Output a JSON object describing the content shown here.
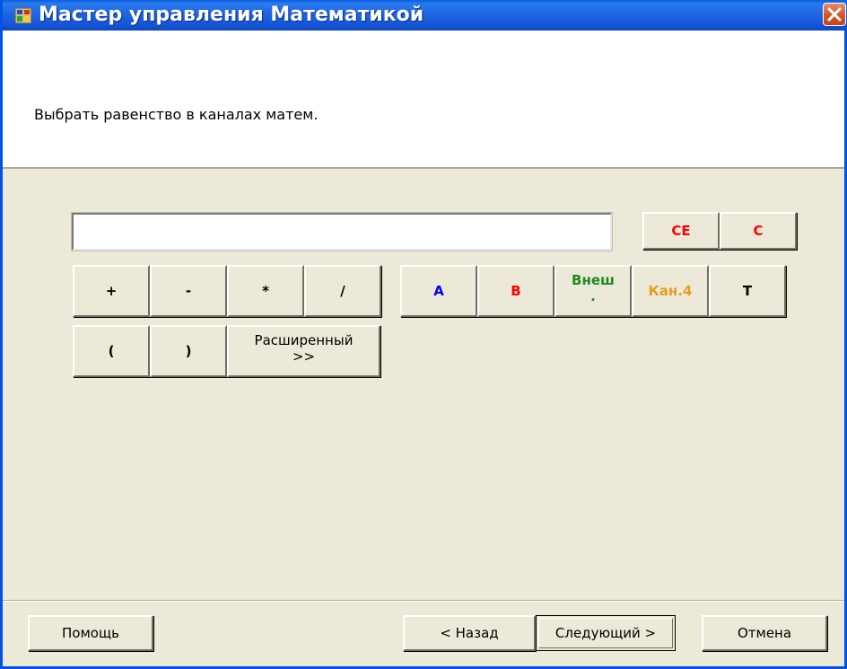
{
  "window": {
    "title": "Мастер управления Математикой",
    "instruction": "Выбрать равенство в каналах матем."
  },
  "calculator": {
    "expression_value": "",
    "clear_entry_label": "CE",
    "clear_label": "C",
    "operators": {
      "plus": "+",
      "minus": "-",
      "multiply": "*",
      "divide": "/",
      "open_paren": "(",
      "close_paren": ")"
    },
    "advanced_label_line1": "Расширенный",
    "advanced_label_line2": ">>",
    "channels": {
      "a": "A",
      "b": "B",
      "ext_line1": "Внеш",
      "ext_line2": ".",
      "ch4": "Кан.4",
      "t": "T"
    }
  },
  "footer": {
    "help_label": "Помощь",
    "back_label": "< Назад",
    "next_label": "Следующий >",
    "cancel_label": "Отмена"
  },
  "colors": {
    "title_bar": "#1e66e4",
    "channel_a": "#0000ff",
    "channel_b": "#ff0000",
    "channel_ext": "#1e8a1e",
    "channel_ch4": "#e0a020",
    "clear_buttons": "#ff0000"
  }
}
